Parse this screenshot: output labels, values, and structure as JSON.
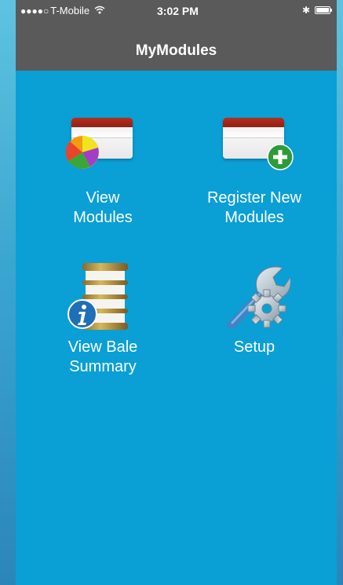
{
  "status": {
    "signal_dots": "●●●●○",
    "carrier": "T-Mobile",
    "time": "3:02 PM",
    "bluetooth": "✱"
  },
  "nav": {
    "title": "MyModules"
  },
  "tiles": [
    {
      "label_line1": "View",
      "label_line2": "Modules",
      "icon": "module-pie-chart-icon"
    },
    {
      "label_line1": "Register New",
      "label_line2": "Modules",
      "icon": "module-add-icon"
    },
    {
      "label_line1": "View Bale",
      "label_line2": "Summary",
      "icon": "bale-info-icon"
    },
    {
      "label_line1": "Setup",
      "label_line2": "",
      "icon": "wrench-gear-icon"
    }
  ],
  "colors": {
    "background": "#0a9fd5",
    "bar": "#5a5a5a",
    "module_red": "#b32f1f",
    "add_green": "#2e9b3a",
    "info_blue": "#1f6fb8"
  }
}
